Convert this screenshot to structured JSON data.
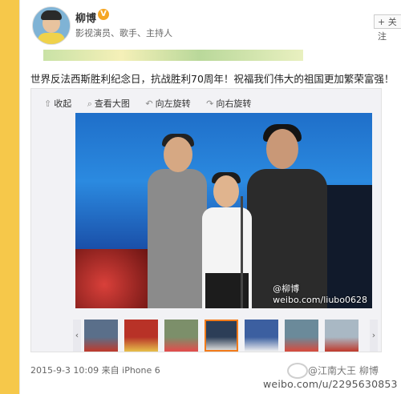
{
  "user": {
    "name": "柳博",
    "verified_badge": "V",
    "title": "影视演员、歌手、主持人",
    "follow_label": "+ 关注"
  },
  "post": {
    "text": "世界反法西斯胜利纪念日，抗战胜利70周年！祝福我们伟大的祖国更加繁荣富强！",
    "photo_watermark": "weibo.com/liubo0628",
    "photo_handle": "@柳博",
    "timestamp": "2015-9-3 10:09",
    "source": "来自 iPhone 6"
  },
  "toolbar": [
    {
      "icon": "collapse-icon",
      "glyph": "⇧",
      "label": "收起"
    },
    {
      "icon": "zoom-icon",
      "glyph": "⌕",
      "label": "查看大图"
    },
    {
      "icon": "rotate-left-icon",
      "glyph": "↶",
      "label": "向左旋转"
    },
    {
      "icon": "rotate-right-icon",
      "glyph": "↷",
      "label": "向右旋转"
    }
  ],
  "thumbnails": [
    {
      "color": "#5a6f8a",
      "accent": "#c0392b"
    },
    {
      "color": "#b83227",
      "accent": "#e7c04a"
    },
    {
      "color": "#7c8f6a",
      "accent": "#e54b4b"
    },
    {
      "color": "#2c3e57",
      "accent": "#d8d8d8",
      "selected": true
    },
    {
      "color": "#3c5fa0",
      "accent": "#f1f1f1"
    },
    {
      "color": "#6b8a9a",
      "accent": "#d84a3c"
    },
    {
      "color": "#a9b8c4",
      "accent": "#c0392b"
    }
  ],
  "page_watermark": {
    "handle": "@江南大王 柳博",
    "url": "weibo.com/u/2295630853"
  },
  "colors": {
    "background": "#f6c84a",
    "accent_orange": "#f27b1a",
    "badge": "#f5a623"
  }
}
